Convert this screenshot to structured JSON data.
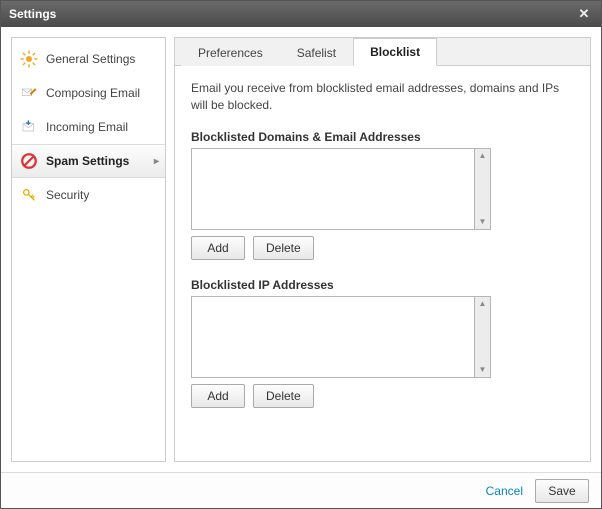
{
  "window": {
    "title": "Settings"
  },
  "sidebar": {
    "items": [
      {
        "label": "General Settings"
      },
      {
        "label": "Composing Email"
      },
      {
        "label": "Incoming Email"
      },
      {
        "label": "Spam Settings"
      },
      {
        "label": "Security"
      }
    ]
  },
  "tabs": [
    {
      "label": "Preferences"
    },
    {
      "label": "Safelist"
    },
    {
      "label": "Blocklist"
    }
  ],
  "blocklist": {
    "description": "Email you receive from blocklisted email addresses, domains and IPs will be blocked.",
    "section1_label": "Blocklisted Domains & Email Addresses",
    "section2_label": "Blocklisted IP Addresses",
    "add_label": "Add",
    "delete_label": "Delete"
  },
  "footer": {
    "cancel_label": "Cancel",
    "save_label": "Save"
  }
}
